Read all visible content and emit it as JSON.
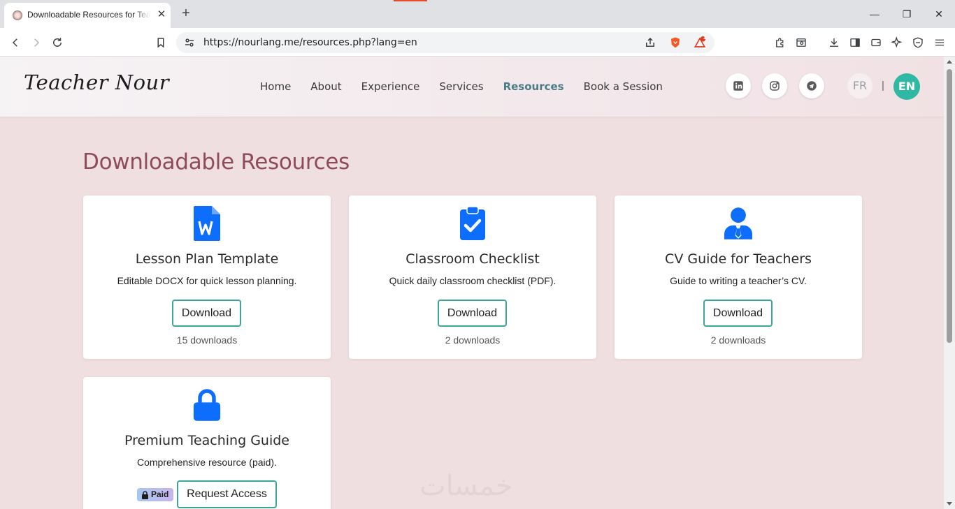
{
  "browser": {
    "tab_title": "Downloadable Resources for Teachers",
    "url": "https://nourlang.me/resources.php?lang=en",
    "notification_count": "1"
  },
  "site": {
    "logo": "Teacher Nour",
    "nav": [
      "Home",
      "About",
      "Experience",
      "Services",
      "Resources",
      "Book a Session"
    ],
    "active_nav": "Resources",
    "lang_fr": "FR",
    "lang_sep": "|",
    "lang_en": "EN"
  },
  "page": {
    "title": "Downloadable Resources"
  },
  "resources": [
    {
      "icon": "word-document-icon",
      "title": "Lesson Plan Template",
      "desc": "Editable DOCX for quick lesson planning.",
      "button": "Download",
      "count": "15 downloads"
    },
    {
      "icon": "clipboard-check-icon",
      "title": "Classroom Checklist",
      "desc": "Quick daily classroom checklist (PDF).",
      "button": "Download",
      "count": "2 downloads"
    },
    {
      "icon": "teacher-person-icon",
      "title": "CV Guide for Teachers",
      "desc": "Guide to writing a teacher’s CV.",
      "button": "Download",
      "count": "2 downloads"
    },
    {
      "icon": "lock-icon",
      "title": "Premium Teaching Guide",
      "desc": "Comprehensive resource (paid).",
      "badge": "Paid",
      "button": "Request Access"
    }
  ],
  "watermark": "خمسات",
  "colors": {
    "accent": "#3aa797",
    "title": "#8e4b5b",
    "icon_blue": "#0d6efd",
    "lang_active": "#2fb8a4"
  }
}
